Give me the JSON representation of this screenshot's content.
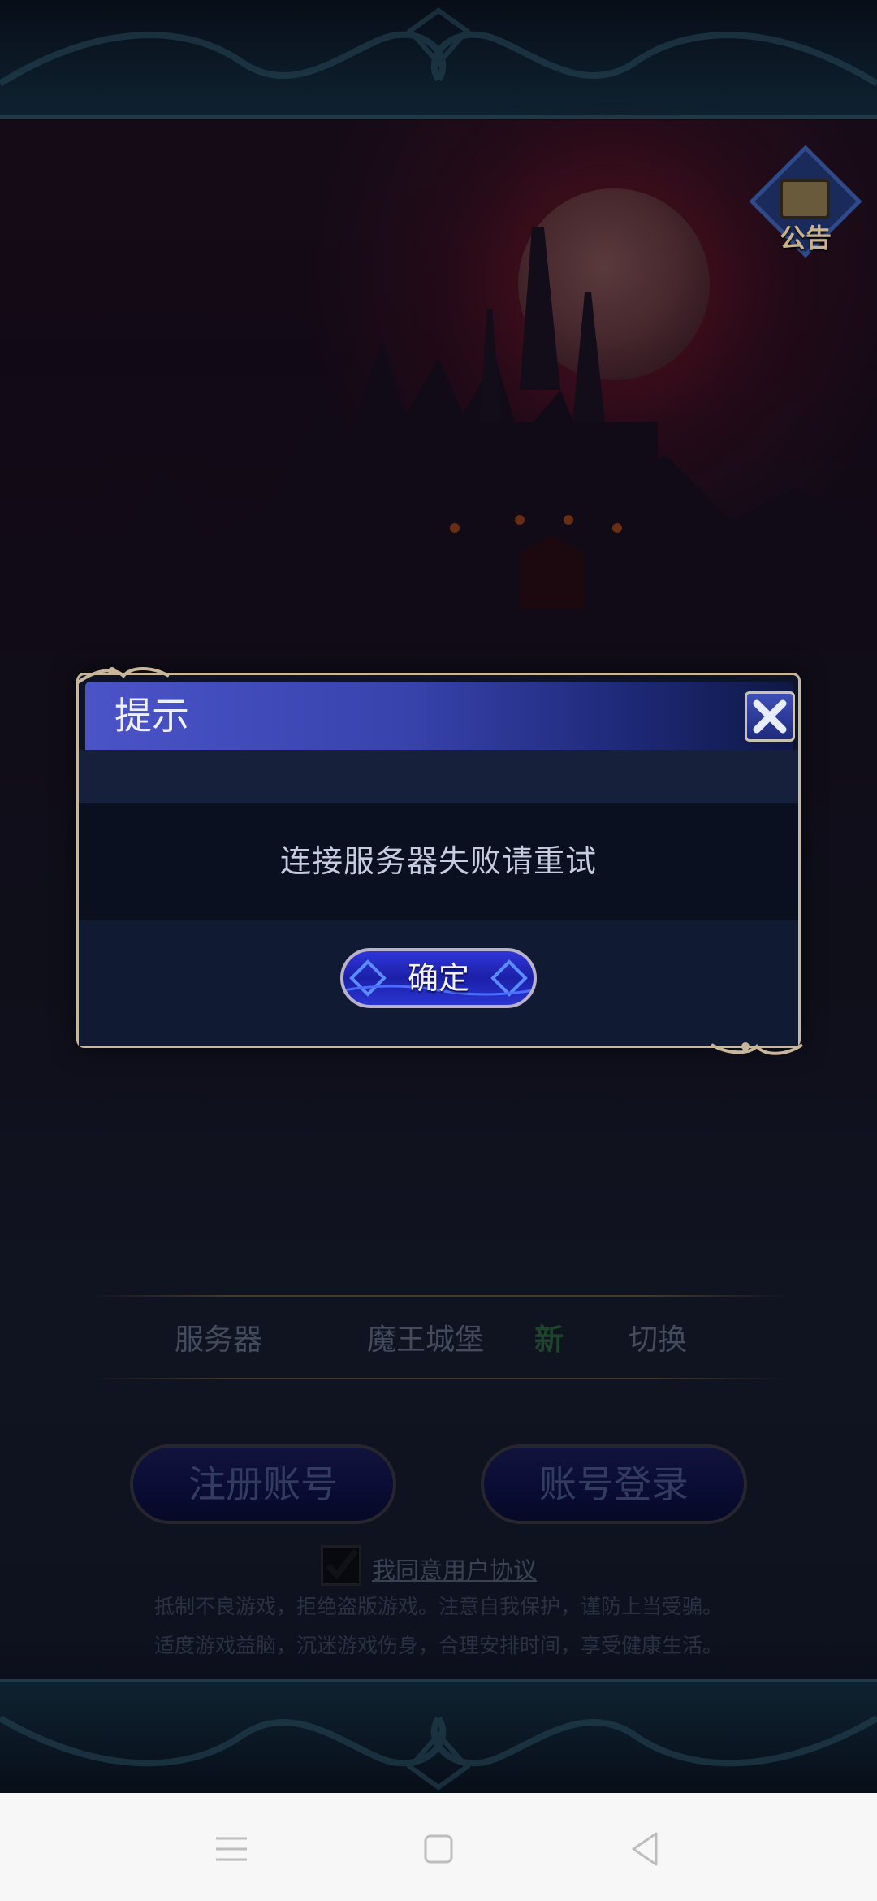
{
  "announcement": {
    "label": "公告"
  },
  "dialog": {
    "title": "提示",
    "message": "连接服务器失败请重试",
    "confirm_label": "确定"
  },
  "server": {
    "label": "服务器",
    "name": "魔王城堡",
    "new_tag": "新",
    "switch_label": "切换"
  },
  "buttons": {
    "register": "注册账号",
    "login": "账号登录"
  },
  "agreement": {
    "checked": true,
    "label": "我同意用户协议"
  },
  "health_notice": [
    "抵制不良游戏，拒绝盗版游戏。注意自我保护，谨防上当受骗。",
    "适度游戏益脑，沉迷游戏伤身，合理安排时间，享受健康生活。"
  ],
  "colors": {
    "dialog_header": "#3843ad",
    "dialog_border": "#c8b79a",
    "confirm_button": "#1b20a8",
    "new_tag": "#2e6a43"
  },
  "navbar": {
    "icons": [
      "menu-icon",
      "home-icon",
      "back-icon"
    ]
  }
}
